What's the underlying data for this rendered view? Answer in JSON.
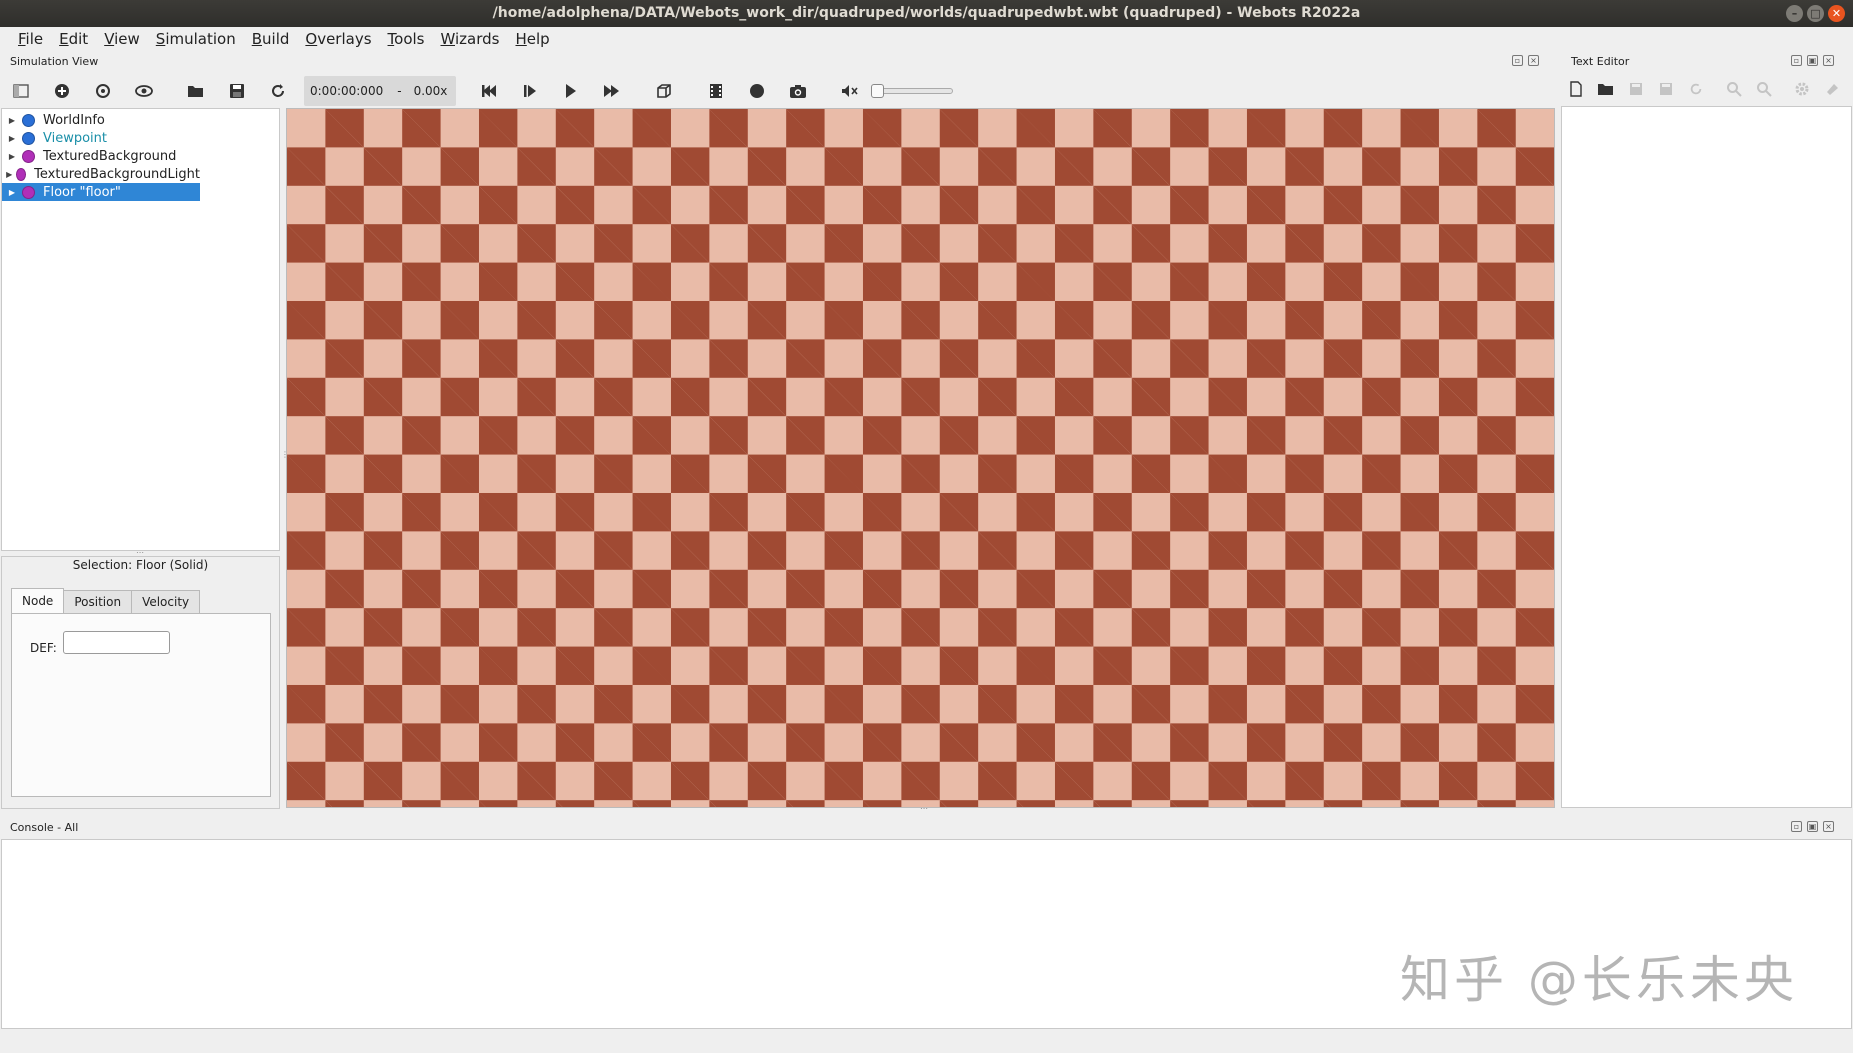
{
  "window": {
    "title": "/home/adolphena/DATA/Webots_work_dir/quadruped/worlds/quadrupedwbt.wbt (quadruped) - Webots R2022a"
  },
  "menubar": {
    "items": [
      "File",
      "Edit",
      "View",
      "Simulation",
      "Build",
      "Overlays",
      "Tools",
      "Wizards",
      "Help"
    ]
  },
  "simulation_view": {
    "header": "Simulation View",
    "toolbar": {
      "time": "0:00:00:000",
      "time_separator": "-",
      "speed": "0.00x",
      "icons": [
        "hide-scene-tree-icon",
        "add-node-icon",
        "reset-view-icon",
        "eye-icon",
        "open-world-icon",
        "save-world-icon",
        "reload-world-icon",
        "reset-simulation-icon",
        "step-icon",
        "play-icon",
        "fast-forward-icon",
        "view-cube-icon",
        "record-movie-icon",
        "record-animation-icon",
        "screenshot-icon",
        "mute-icon"
      ],
      "volume_level": 0.0
    },
    "scene_tree": {
      "nodes": [
        {
          "label": "WorldInfo",
          "ball_color": "#2a6fd6",
          "selected": false,
          "teal": false
        },
        {
          "label": "Viewpoint",
          "ball_color": "#2a6fd6",
          "selected": false,
          "teal": true
        },
        {
          "label": "TexturedBackground",
          "ball_color": "#b02fb8",
          "selected": false,
          "teal": false
        },
        {
          "label": "TexturedBackgroundLight",
          "ball_color": "#b02fb8",
          "selected": false,
          "teal": false
        },
        {
          "label": "Floor \"floor\"",
          "ball_color": "#b02fb8",
          "selected": true,
          "teal": false
        }
      ]
    },
    "field_editor": {
      "selection": "Selection: Floor (Solid)",
      "tabs": [
        "Node",
        "Position",
        "Velocity"
      ],
      "active_tab": "Node",
      "def_label": "DEF:",
      "def_value": ""
    }
  },
  "text_editor": {
    "header": "Text Editor",
    "icons": [
      "new-file-icon",
      "open-file-icon",
      "save-icon",
      "save-all-icon",
      "revert-icon",
      "find-icon",
      "replace-icon",
      "settings-icon",
      "clear-icon"
    ]
  },
  "console": {
    "header": "Console - All"
  },
  "watermark": {
    "text": "知乎 @长乐未央"
  }
}
